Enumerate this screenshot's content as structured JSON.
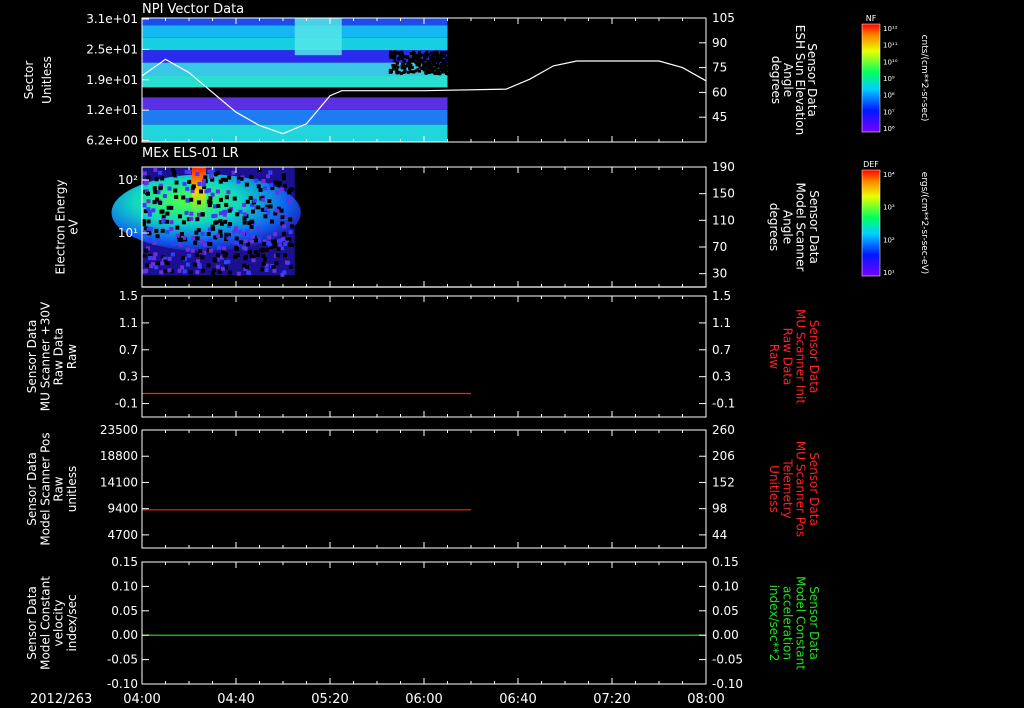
{
  "date": "2012/263",
  "x_ticks": [
    "04:00",
    "04:40",
    "05:20",
    "06:00",
    "06:40",
    "07:20",
    "08:00"
  ],
  "colorbars": [
    {
      "tag": "NF",
      "unit": "cnts/(cm**2-sr-sec)",
      "ticks": [
        "10¹²",
        "10¹¹",
        "10¹⁰",
        "10⁹",
        "10⁸",
        "10⁷",
        "10⁶"
      ]
    },
    {
      "tag": "DEF",
      "unit": "ergs/(cm**2-sr-sec-eV)",
      "ticks": [
        "10⁴",
        "10³",
        "10²",
        "10¹"
      ]
    }
  ],
  "chart_data": [
    {
      "type": "heatmap",
      "title": "NPI Vector Data",
      "ylabel": [
        "Sector",
        "Unitless"
      ],
      "yticks": [
        "3.1e+01",
        "2.5e+01",
        "1.9e+01",
        "1.2e+01",
        "6.2e+00"
      ],
      "ylabel_right": [
        "Sensor Data",
        "ESH Sun Elevation",
        "Angle",
        "degrees"
      ],
      "yticks_right": [
        105,
        90,
        75,
        60,
        45
      ],
      "ylim_right": [
        30,
        105
      ],
      "right_color": "#ffffff",
      "line": {
        "name": "ESH Sun Elevation Angle",
        "color": "#ffffff",
        "x": [
          "04:00",
          "04:10",
          "04:20",
          "04:30",
          "04:40",
          "04:50",
          "05:00",
          "05:10",
          "05:20",
          "05:25",
          "05:30",
          "06:00",
          "06:35",
          "06:45",
          "06:55",
          "07:05",
          "07:40",
          "07:50",
          "08:00"
        ],
        "y": [
          70,
          80,
          72,
          60,
          48,
          40,
          35,
          41,
          58,
          61,
          61,
          61,
          62,
          68,
          76,
          79,
          79,
          75,
          67
        ]
      },
      "heat_span": [
        "04:00",
        "06:10"
      ],
      "heat_bands": [
        {
          "y0": 0.0,
          "y1": 0.06,
          "color": "#1d4ce8"
        },
        {
          "y0": 0.06,
          "y1": 0.16,
          "color": "#14b7f2"
        },
        {
          "y0": 0.16,
          "y1": 0.26,
          "color": "#17cfe2"
        },
        {
          "y0": 0.26,
          "y1": 0.36,
          "color": "#2a2af0"
        },
        {
          "y0": 0.36,
          "y1": 0.46,
          "color": "#3ac6e6"
        },
        {
          "y0": 0.46,
          "y1": 0.56,
          "color": "#28dfd0"
        },
        {
          "y0": 0.56,
          "y1": 0.64,
          "color": "#000000"
        },
        {
          "y0": 0.64,
          "y1": 0.74,
          "color": "#5a30e2"
        },
        {
          "y0": 0.74,
          "y1": 0.86,
          "color": "#1f7bf2"
        },
        {
          "y0": 0.86,
          "y1": 1.0,
          "color": "#20d6dc"
        }
      ]
    },
    {
      "type": "heatmap",
      "title": "MEx ELS-01 LR",
      "ylabel": [
        "Electron Energy",
        "eV"
      ],
      "yticks": [
        "10²",
        "10¹"
      ],
      "ylabel_right": [
        "Sensor Data",
        "Model Scanner",
        "Angle",
        "degrees"
      ],
      "yticks_right": [
        190,
        150,
        110,
        70,
        30
      ],
      "ylim_right": [
        10,
        190
      ],
      "right_color": "#ffffff",
      "line": {
        "name": "Model Scanner Angle",
        "color": "#ffffff",
        "x": [
          "04:00",
          "08:00"
        ],
        "y": [
          10,
          10
        ]
      },
      "heat_span": [
        "04:00",
        "05:05"
      ]
    },
    {
      "type": "line",
      "ylabel": [
        "Sensor Data",
        "MU Scanner +30V",
        "Raw Data",
        "Raw"
      ],
      "yticks": [
        "1.5",
        "1.1",
        "0.7",
        "0.3",
        "-0.1"
      ],
      "ylim": [
        -0.3,
        1.5
      ],
      "ylabel_right": [
        "Sensor Data",
        "MU Scanner Init",
        "Raw Data",
        "Raw"
      ],
      "yticks_right": [
        "1.5",
        "1.1",
        "0.7",
        "0.3",
        "-0.1"
      ],
      "right_color": "#ff2020",
      "line": {
        "name": "MU Scanner Init Raw Data",
        "color": "#ff2020",
        "x": [
          "04:00",
          "06:20"
        ],
        "y": [
          0.05,
          0.05
        ]
      }
    },
    {
      "type": "line",
      "ylabel": [
        "Sensor Data",
        "Model Scanner Pos",
        "Raw",
        "unitless"
      ],
      "yticks": [
        "23500",
        "18800",
        "14100",
        "9400",
        "4700"
      ],
      "ylim": [
        0,
        23500
      ],
      "ylabel_right": [
        "Sensor Data",
        "MU Scanner Pos",
        "Telemetry",
        "Unitless"
      ],
      "yticks_right": [
        "260",
        "206",
        "152",
        "98",
        "44"
      ],
      "right_color": "#ff2020",
      "line": {
        "name": "MU Scanner Pos Telemetry",
        "color": "#ff2020",
        "x": [
          "04:00",
          "06:20"
        ],
        "y": [
          7600,
          7600
        ]
      }
    },
    {
      "type": "line",
      "ylabel": [
        "Sensor Data",
        "Model Constant",
        "velocity",
        "index/sec"
      ],
      "yticks": [
        "0.15",
        "0.10",
        "0.05",
        "0.00",
        "-0.05",
        "-0.10"
      ],
      "ylim": [
        -0.1,
        0.15
      ],
      "ylabel_right": [
        "Sensor Data",
        "Model Constant",
        "acceleration",
        "index/sec**2"
      ],
      "yticks_right": [
        "0.15",
        "0.10",
        "0.05",
        "0.00",
        "-0.05",
        "-0.10"
      ],
      "right_color": "#20e020",
      "line": {
        "name": "Model Constant acceleration",
        "color": "#20e020",
        "x": [
          "04:00",
          "08:00"
        ],
        "y": [
          0.0,
          0.0
        ]
      }
    }
  ]
}
